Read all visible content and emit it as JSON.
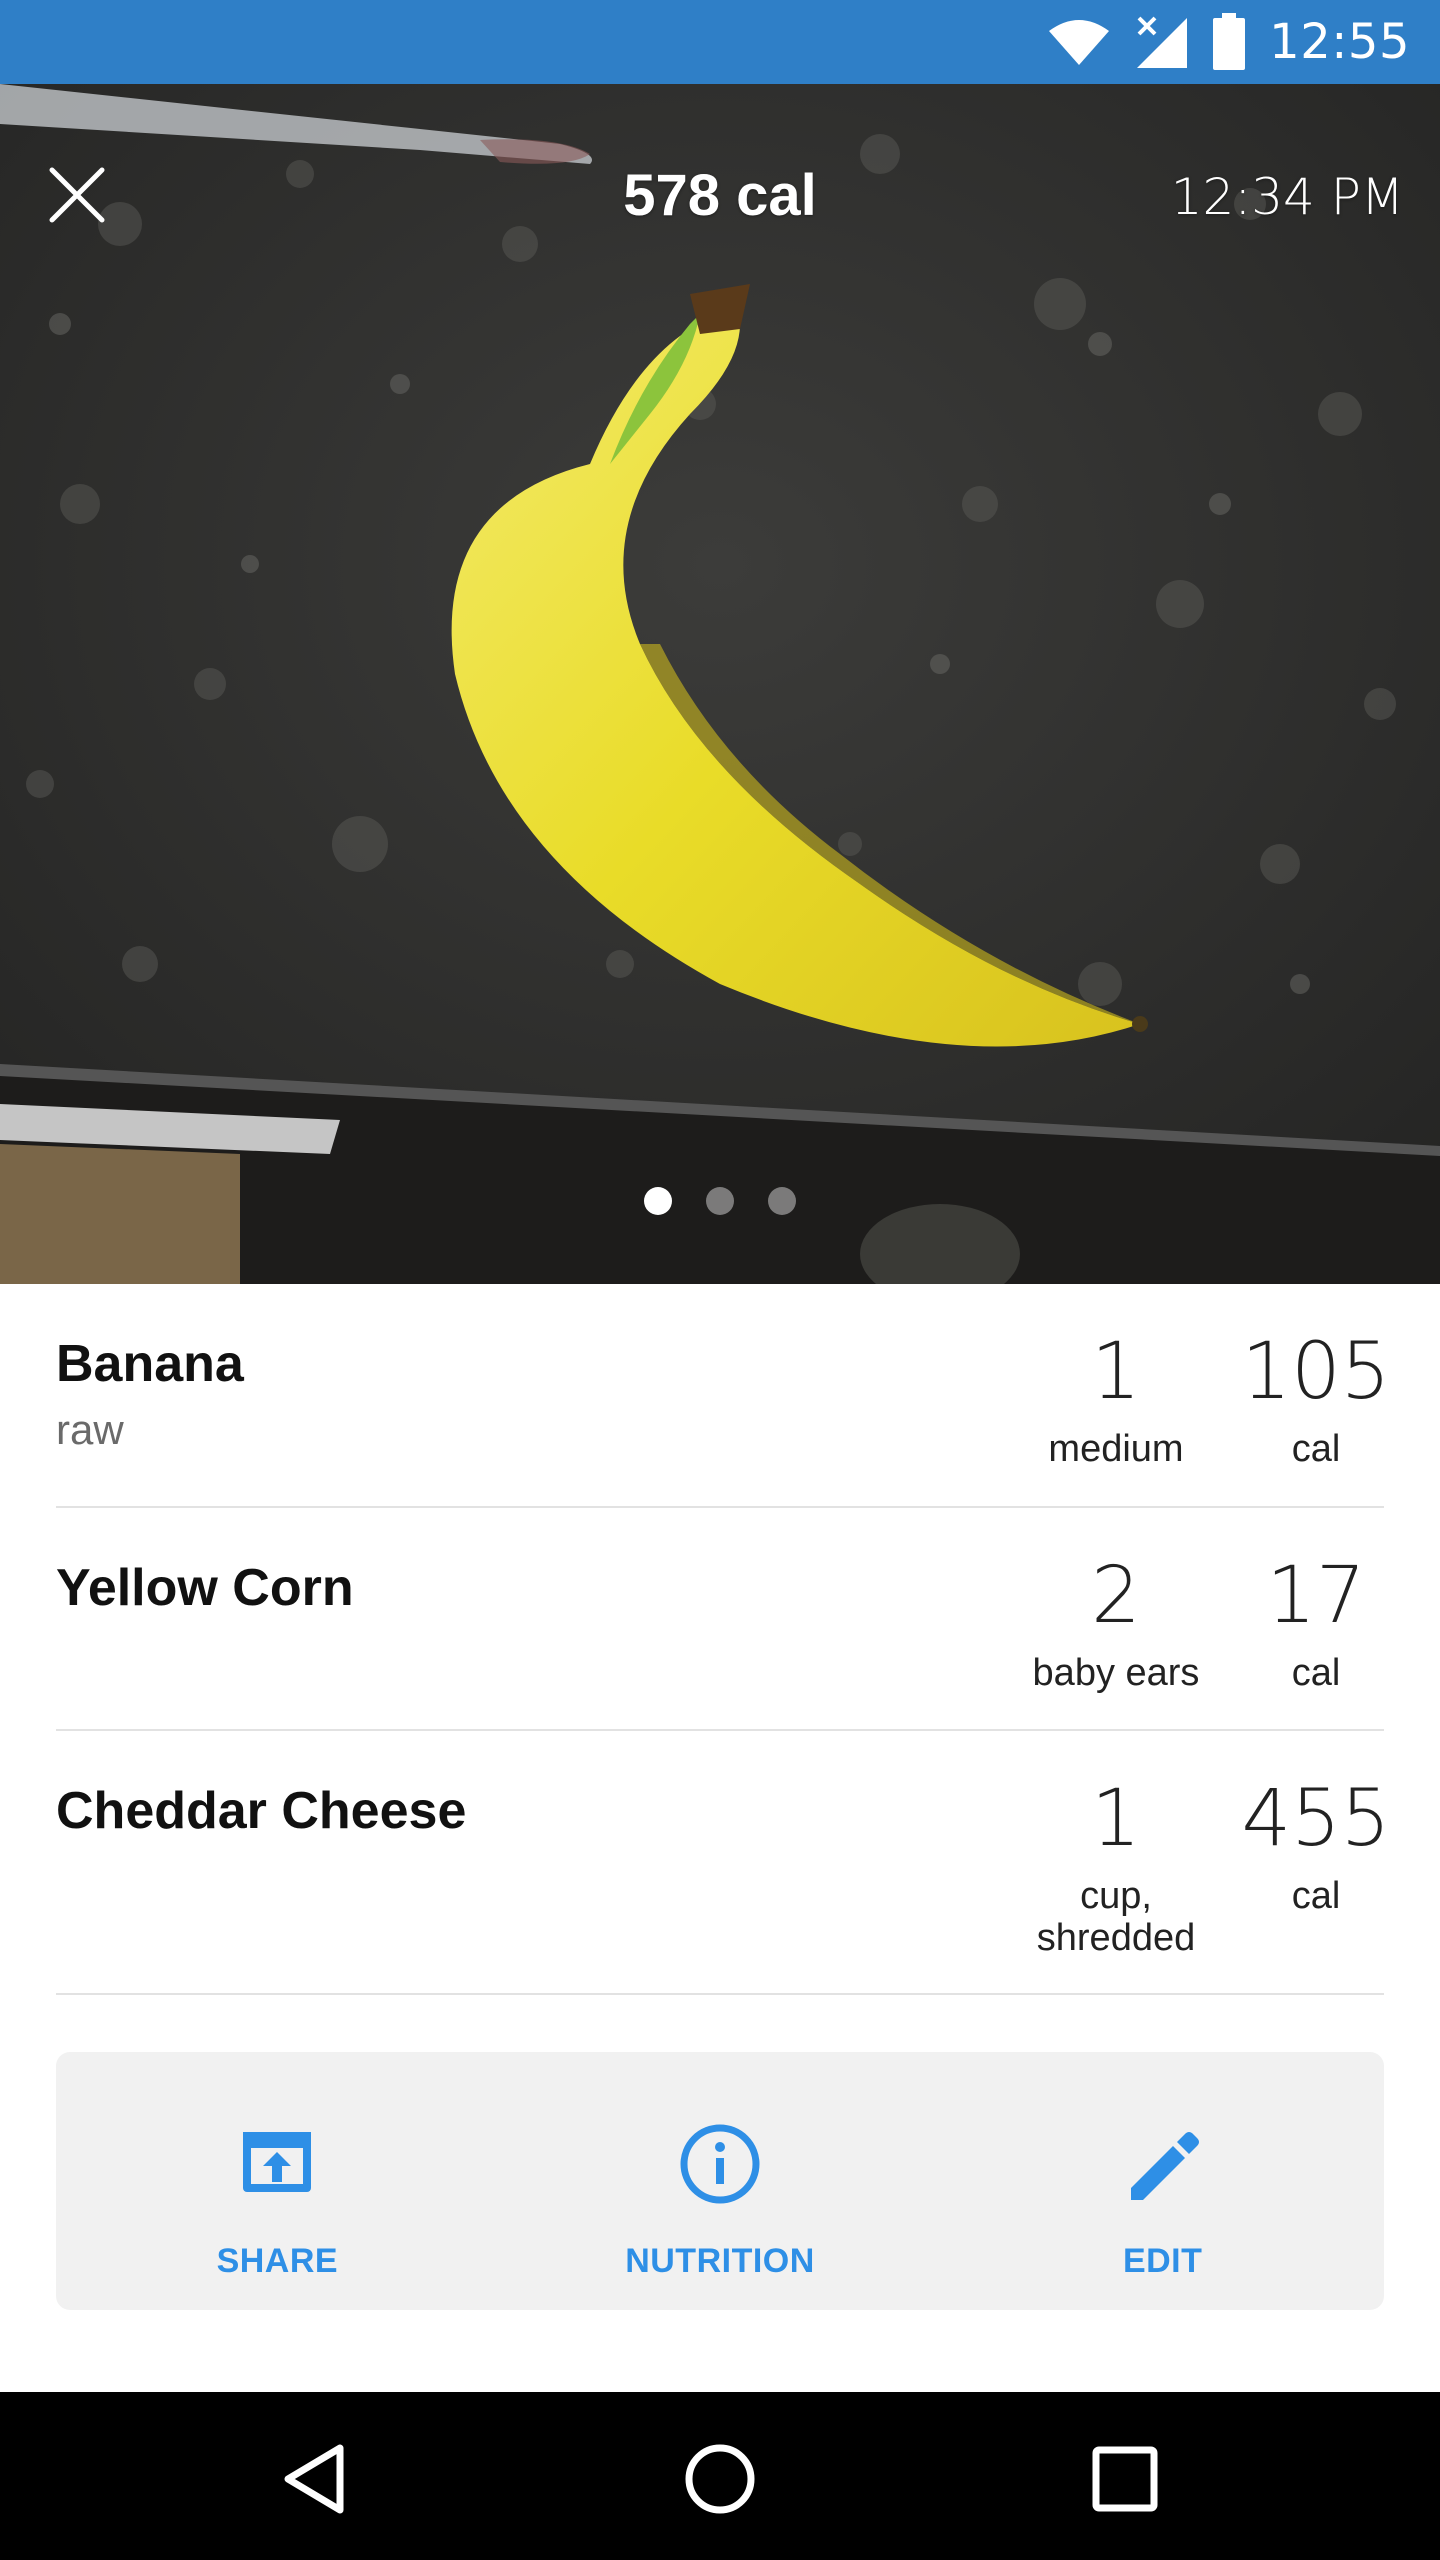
{
  "status_bar": {
    "time": "12:55",
    "icons": [
      "wifi-icon",
      "cellular-no-signal-icon",
      "battery-icon"
    ],
    "background": "#2f7fc7"
  },
  "header": {
    "total_calories": "578 cal",
    "time": "12:34 PM",
    "close_icon": "close-icon"
  },
  "photo": {
    "subject": "banana on granite countertop",
    "page_count": 3,
    "active_page": 1
  },
  "foods": [
    {
      "name": "Banana",
      "description": "raw",
      "quantity": "1",
      "unit": "medium",
      "calories": "105",
      "cal_unit": "cal"
    },
    {
      "name": "Yellow Corn",
      "description": "",
      "quantity": "2",
      "unit": "baby ears",
      "calories": "17",
      "cal_unit": "cal"
    },
    {
      "name": "Cheddar Cheese",
      "description": "",
      "quantity": "1",
      "unit_line1": "cup,",
      "unit_line2": "shredded",
      "calories": "455",
      "cal_unit": "cal"
    }
  ],
  "actions": [
    {
      "label": "SHARE",
      "icon": "share-icon"
    },
    {
      "label": "NUTRITION",
      "icon": "info-icon"
    },
    {
      "label": "EDIT",
      "icon": "pencil-icon"
    }
  ],
  "colors": {
    "accent": "#2e8fe6",
    "nav_bar": "#000000"
  },
  "nav_bar": {
    "buttons": [
      "back-icon",
      "home-icon",
      "recents-icon"
    ]
  }
}
